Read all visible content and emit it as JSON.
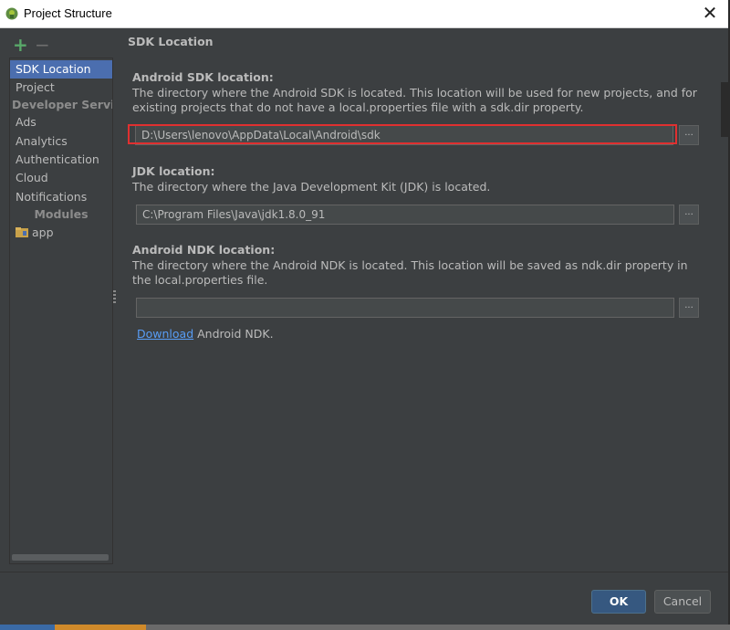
{
  "window": {
    "title": "Project Structure",
    "close_glyph": "✕",
    "app_icon": "android-studio-icon"
  },
  "toolbar": {
    "add_glyph": "+",
    "remove_glyph": "−"
  },
  "sidebar": {
    "items": [
      {
        "label": "SDK Location",
        "selected": true
      },
      {
        "label": "Project",
        "selected": false
      }
    ],
    "developer_services_header": "Developer Services",
    "developer_services": [
      {
        "label": "Ads"
      },
      {
        "label": "Analytics"
      },
      {
        "label": "Authentication"
      },
      {
        "label": "Cloud"
      },
      {
        "label": "Notifications"
      }
    ],
    "modules_header": "Modules",
    "modules": [
      {
        "label": "app",
        "icon": "module-folder-icon"
      }
    ]
  },
  "main": {
    "section_title": "SDK Location",
    "android_sdk": {
      "label": "Android SDK location:",
      "description": "The directory where the Android SDK is located. This location will be used for new projects, and for existing projects that do not have a local.properties file with a sdk.dir property.",
      "value": "D:\\Users\\lenovo\\AppData\\Local\\Android\\sdk",
      "browse_label": "..."
    },
    "jdk": {
      "label": "JDK location:",
      "description": "The directory where the Java Development Kit (JDK) is located.",
      "value": "C:\\Program Files\\Java\\jdk1.8.0_91",
      "browse_label": "..."
    },
    "ndk": {
      "label": "Android NDK location:",
      "description": "The directory where the Android NDK is located. This location will be saved as ndk.dir property in the local.properties file.",
      "value": "",
      "browse_label": "...",
      "download_link": "Download",
      "download_suffix": " Android NDK."
    }
  },
  "footer": {
    "ok_label": "OK",
    "cancel_label": "Cancel"
  },
  "colors": {
    "background": "#3c3f41",
    "selection": "#4b6eaf",
    "highlight_box": "#e03030",
    "link": "#589df6",
    "ok_button": "#365880"
  }
}
